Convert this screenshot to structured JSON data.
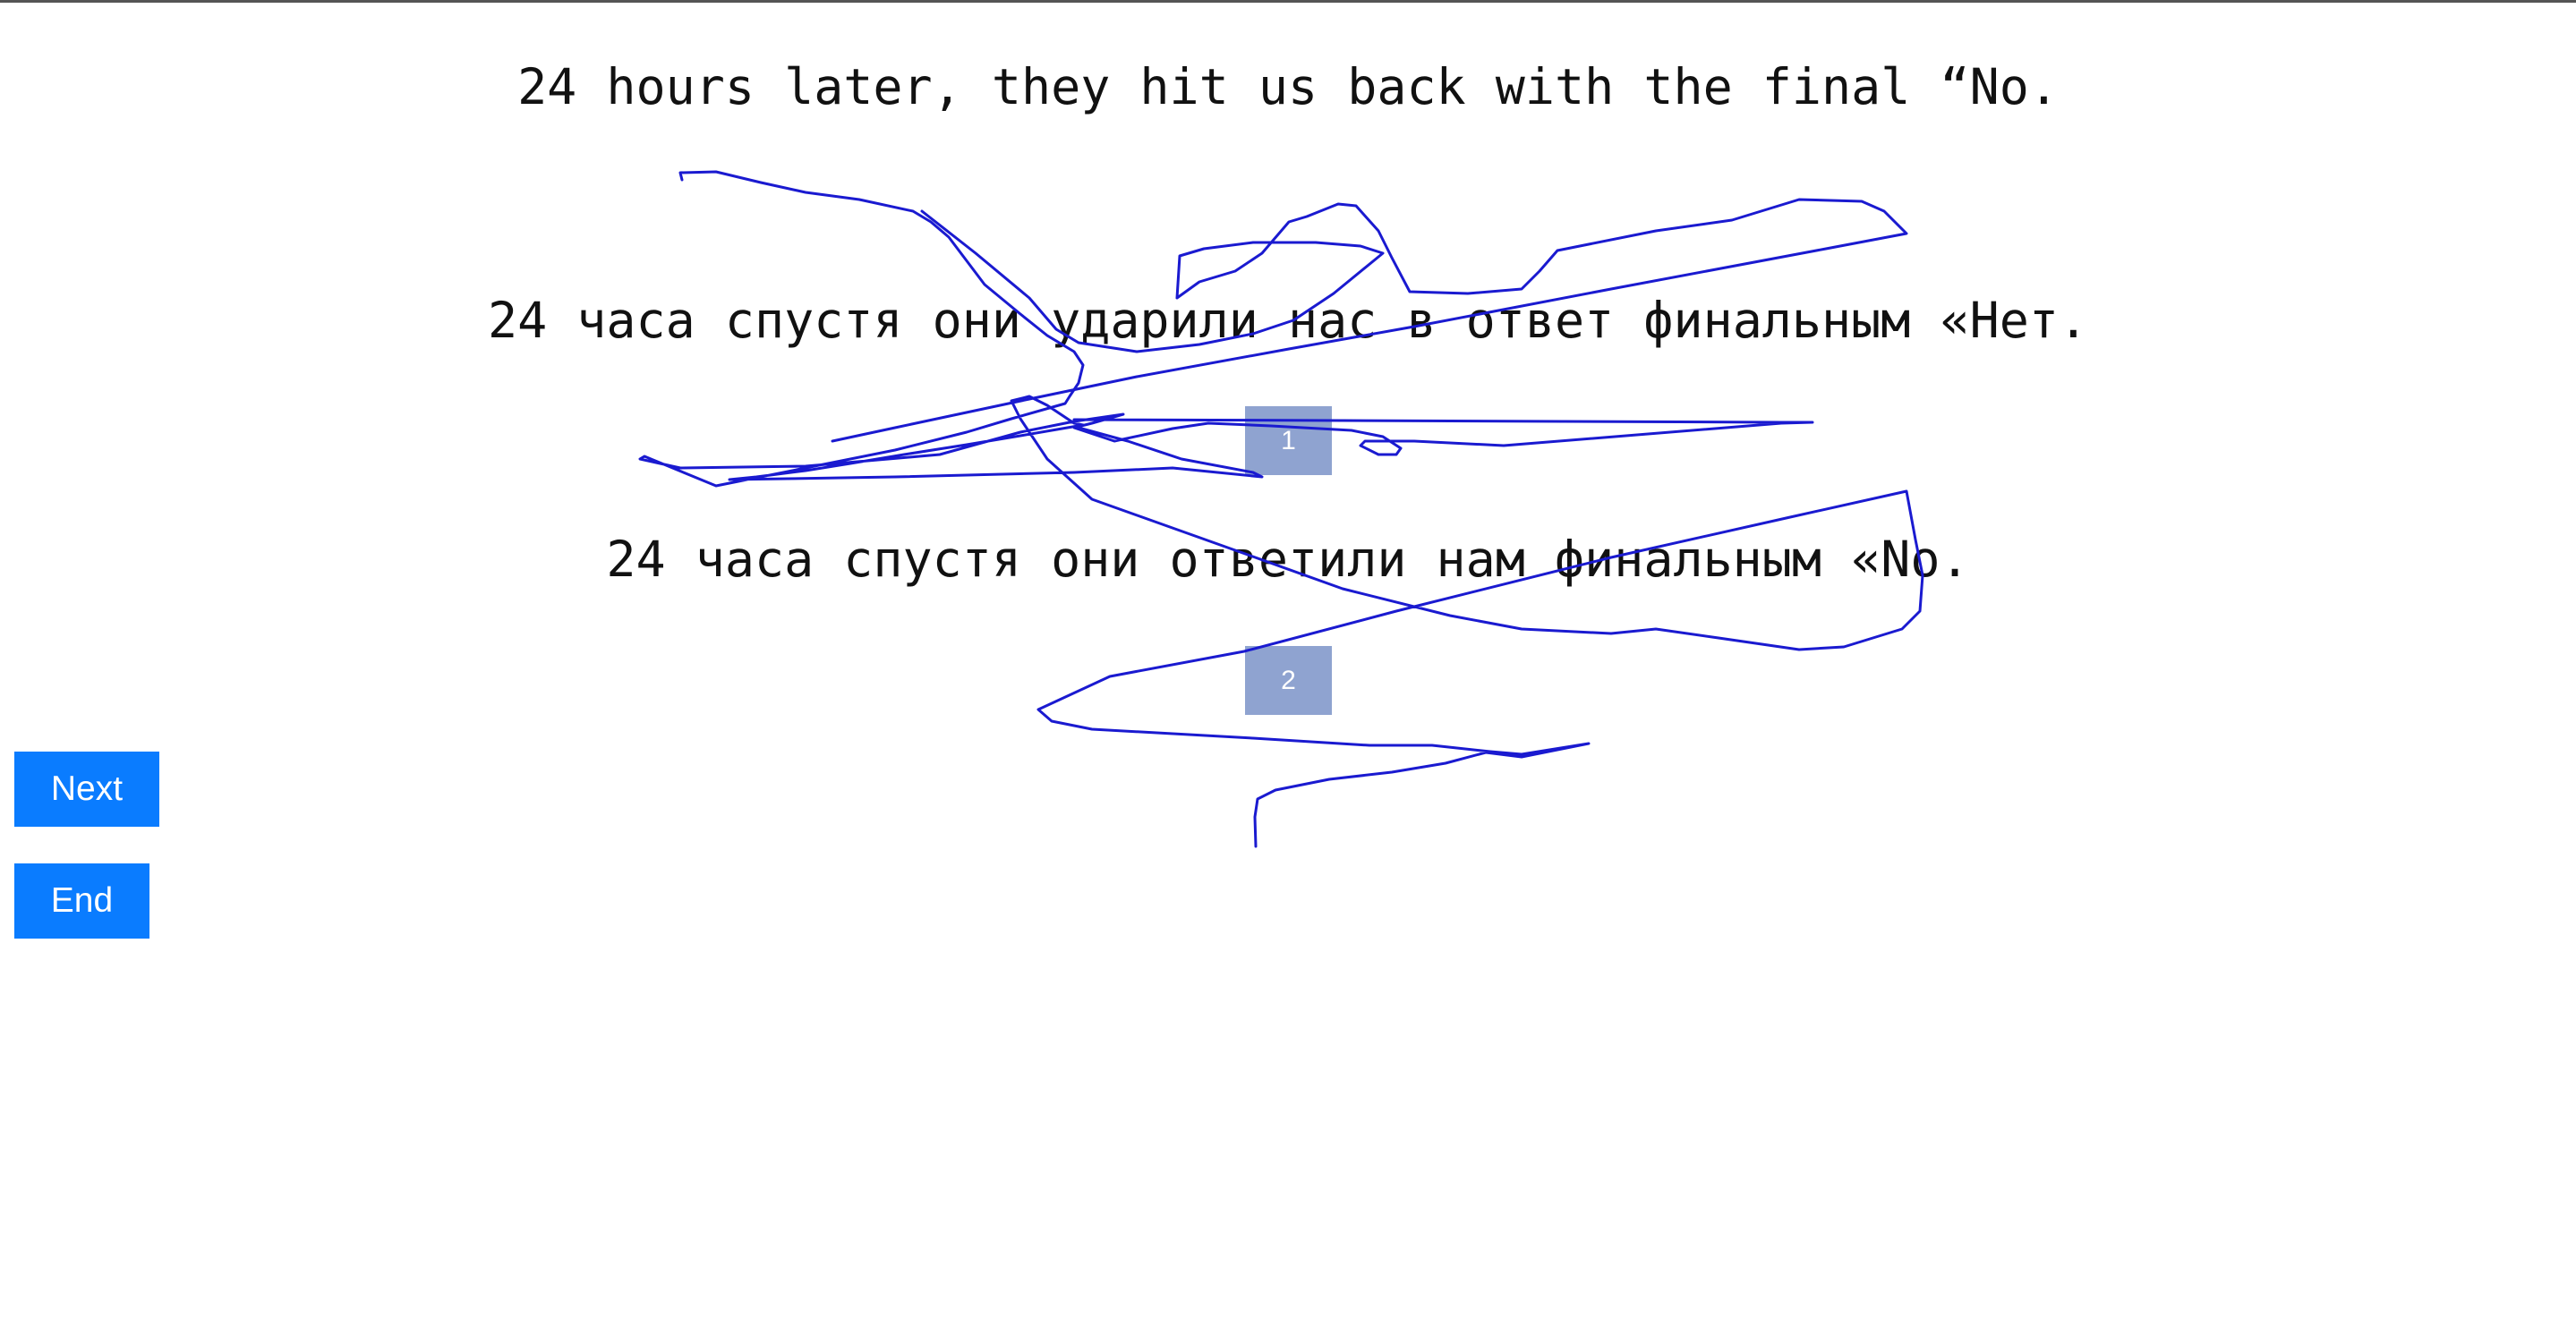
{
  "source_sentence": "24 hours later, they hit us back with the final “No.",
  "candidates": [
    {
      "text": "24 часа спустя они ударили нас в ответ финальным «Нет.",
      "badge": "1"
    },
    {
      "text": "24 часа спустя они ответили нам финальным «No.",
      "badge": "2"
    }
  ],
  "buttons": {
    "next_label": "Next",
    "end_label": "End"
  },
  "colors": {
    "button": "#0a7cff",
    "badge": "#8fa3d0",
    "scribble": "#1a1ad0"
  }
}
